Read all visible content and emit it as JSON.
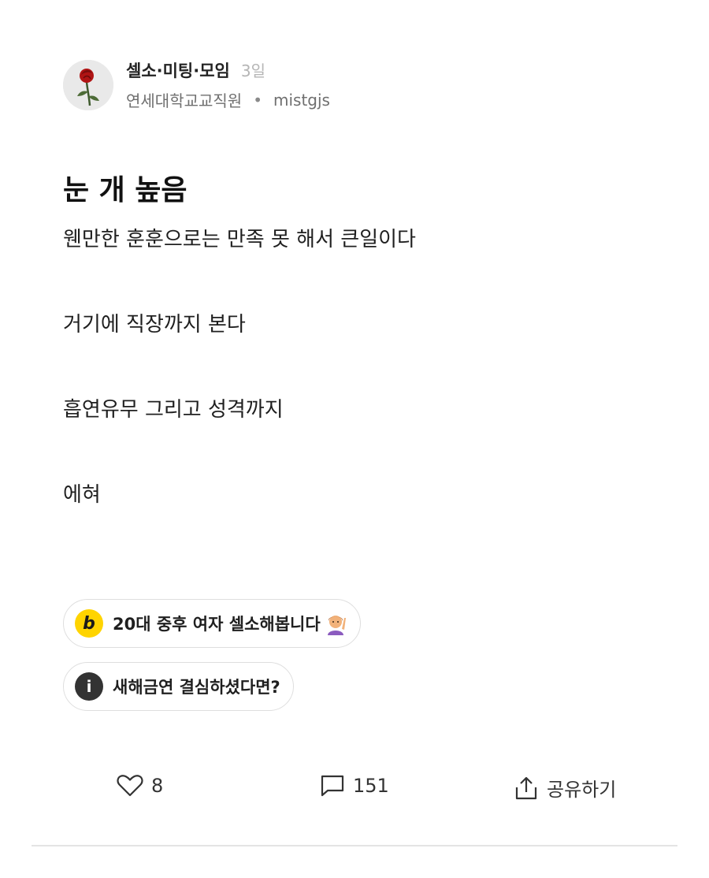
{
  "post": {
    "board": "셀소·미팅·모임",
    "time": "3일",
    "author_org": "연세대학교교직원",
    "separator": "•",
    "author_id": "mistgjs",
    "title": "눈 개 높음",
    "body": [
      "웬만한 훈훈으로는 만족 못 해서 큰일이다",
      "거기에 직장까지 본다",
      "흡연유무 그리고 성격까지",
      "에혀"
    ]
  },
  "links": [
    {
      "icon_text": "b",
      "icon": "b-logo-icon",
      "label": "20대 중후 여자 셀소해봅니다",
      "emoji": "person-raising-hand-emoji",
      "color": "#ffd400"
    },
    {
      "icon_text": "i",
      "icon": "info-icon",
      "label": "새해금연 결심하셨다면?",
      "color": "#333333"
    }
  ],
  "actions": {
    "like_count": "8",
    "comment_count": "151",
    "share_label": "공유하기"
  },
  "colors": {
    "accent_yellow": "#ffd400",
    "text": "#1a1a1a",
    "muted": "#6f6f6f"
  }
}
